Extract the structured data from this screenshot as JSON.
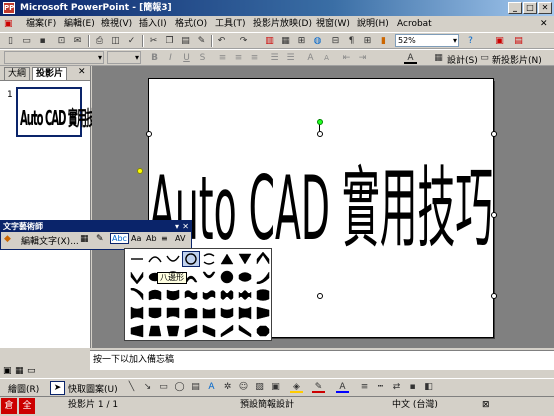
{
  "window": {
    "title": "Microsoft PowerPoint - [簡報3]",
    "app_icon": "PP"
  },
  "menu": [
    "檔案(F)",
    "編輯(E)",
    "檢視(V)",
    "插入(I)",
    "格式(O)",
    "工具(T)",
    "投影片放映(D)",
    "視窗(W)",
    "說明(H)",
    "Acrobat"
  ],
  "toolbar": {
    "zoom": "52%",
    "design_label": "設計(S)",
    "new_slide_label": "新投影片(N)"
  },
  "left_pane": {
    "tab_outline": "大綱",
    "tab_slides": "投影片",
    "tab_close": "✕",
    "slide_number": "1",
    "thumb_text": "Auto CAD 實用技巧"
  },
  "slide": {
    "wordart_text": "Auto CAD 實用技巧"
  },
  "wordart_toolbar": {
    "title": "文字藝術師",
    "edit_text_label": "編輯文字(X)...",
    "icon_labels": [
      "Aa",
      "Ab",
      "AV"
    ]
  },
  "shape_palette": {
    "tooltip": "八邊形",
    "shapes": [
      "plain-text",
      "arch-up",
      "arch-down",
      "circle",
      "button",
      "triangle-up",
      "triangle-down",
      "chevron-up",
      "chevron-down",
      "ring-inside",
      "ring-outside",
      "arch-up-pour",
      "arch-down-pour",
      "circle-pour",
      "button-pour",
      "curve-up",
      "curve-down",
      "can-up",
      "can-down",
      "wave1",
      "wave2",
      "double-wave1",
      "double-wave2",
      "inflate",
      "deflate",
      "inflate-bottom",
      "deflate-bottom",
      "inflate-top",
      "deflate-top",
      "deflate-inflate",
      "deflate-inflate-deflate",
      "fade-right",
      "fade-left",
      "fade-up",
      "fade-down",
      "slant-up",
      "slant-down",
      "cascade-up",
      "cascade-down",
      "octagon"
    ]
  },
  "notes": {
    "placeholder": "按一下以加入備忘稿"
  },
  "drawing_toolbar": {
    "draw_label": "繪圖(R)",
    "autoshapes_label": "快取圖案(U)"
  },
  "status": {
    "slide_pos": "投影片 1 / 1",
    "design": "預設簡報設計",
    "language": "中文 (台灣)"
  },
  "colors": {
    "titlebar": "#0a246a",
    "wordart_fill": "#000000",
    "slide_bg": "#ffffff",
    "workspace": "#808080"
  }
}
